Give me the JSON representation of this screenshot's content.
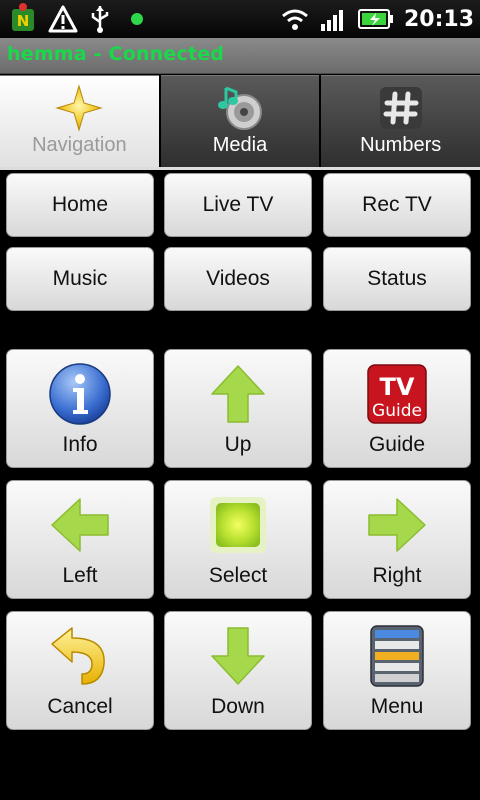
{
  "statusbar": {
    "time": "20:13"
  },
  "titlebar": {
    "title": "hemma - Connected"
  },
  "tabs": [
    {
      "label": "Navigation",
      "icon": "navigation-star-icon",
      "active": true
    },
    {
      "label": "Media",
      "icon": "media-disc-icon",
      "active": false
    },
    {
      "label": "Numbers",
      "icon": "hash-icon",
      "active": false
    }
  ],
  "nav_buttons": [
    {
      "label": "Home"
    },
    {
      "label": "Live TV"
    },
    {
      "label": "Rec TV"
    },
    {
      "label": "Music"
    },
    {
      "label": "Videos"
    },
    {
      "label": "Status"
    }
  ],
  "dpad": [
    {
      "label": "Info",
      "icon": "info-icon"
    },
    {
      "label": "Up",
      "icon": "arrow-up-icon"
    },
    {
      "label": "Guide",
      "icon": "tv-guide-icon",
      "icon_text": [
        "TV",
        "Guide"
      ]
    },
    {
      "label": "Left",
      "icon": "arrow-left-icon"
    },
    {
      "label": "Select",
      "icon": "select-square-icon"
    },
    {
      "label": "Right",
      "icon": "arrow-right-icon"
    },
    {
      "label": "Cancel",
      "icon": "undo-arrow-icon"
    },
    {
      "label": "Down",
      "icon": "arrow-down-icon"
    },
    {
      "label": "Menu",
      "icon": "menu-list-icon"
    }
  ],
  "colors": {
    "connected": "#19d84a",
    "arrow_green": "#a5d84a",
    "tv_guide_red": "#c8141e"
  }
}
